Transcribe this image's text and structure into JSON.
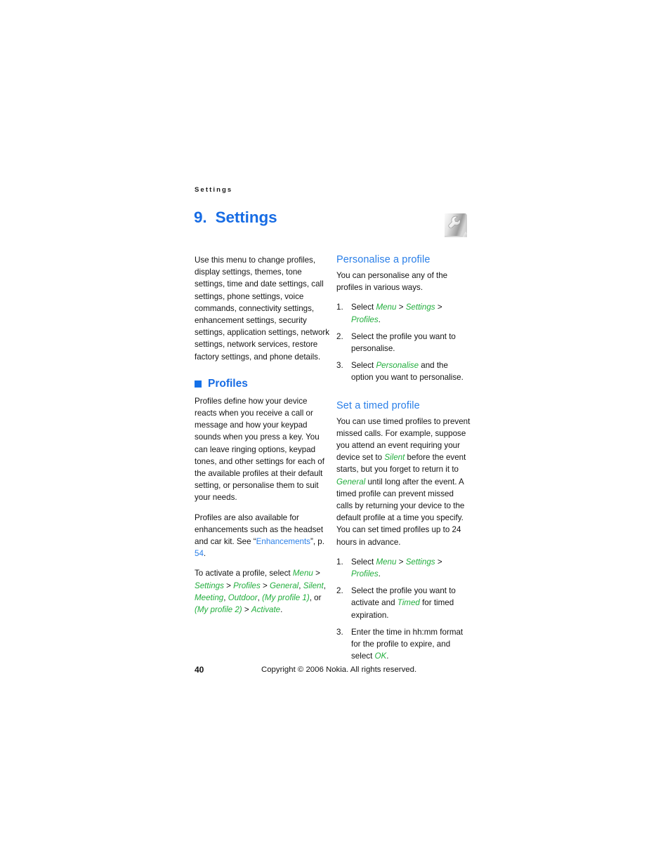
{
  "page": {
    "running_header": "Settings",
    "footer_page_number": "40",
    "footer_copyright": "Copyright © 2006 Nokia. All rights reserved.",
    "colors": {
      "heading_blue": "#176ce4",
      "subheading_blue": "#2a7fe8",
      "menu_green": "#22ae3d",
      "link_blue": "#2a7fe8",
      "body_black": "#141414"
    }
  },
  "chapter": {
    "number": "9.",
    "title": "Settings",
    "icon": "wrench-icon"
  },
  "intro": {
    "text": "Use this menu to change profiles, display settings, themes, tone settings, time and date settings, call settings, phone settings, voice commands, connectivity settings, enhancement settings, security settings, application settings, network settings, network services, restore factory settings, and phone details."
  },
  "profiles_section": {
    "heading": "Profiles",
    "para_1": "Profiles define how your device reacts when you receive a call or message and how your keypad sounds when you press a key. You can leave ringing options, keypad tones, and other settings for each of the available profiles at their default setting, or personalise them to suit your needs.",
    "para_2": {
      "before": "Profiles are also available for enhancements such as the headset and car kit. See “",
      "link": "Enhancements",
      "middle": "”, p. ",
      "page_ref": "54",
      "after": "."
    },
    "para_3": {
      "before": "To activate a profile, select ",
      "menu_1": "Menu",
      "sep_1": " > ",
      "menu_2": "Settings",
      "sep_2": " > ",
      "menu_3": "Profiles",
      "sep_3": " > ",
      "menu_4": "General",
      "comma_1": ", ",
      "menu_5": "Silent",
      "comma_2": ", ",
      "menu_6": "Meeting",
      "comma_3": ", ",
      "menu_7": "Outdoor",
      "comma_4": ", ",
      "menu_8": "(My profile 1)",
      "or_text": ", or ",
      "menu_9": "(My profile 2)",
      "sep_4": " > ",
      "menu_10": "Activate",
      "after": "."
    }
  },
  "personalise_section": {
    "heading": "Personalise a profile",
    "intro": "You can personalise any of the profiles in various ways.",
    "steps": [
      {
        "before": "Select ",
        "menu_1": "Menu",
        "sep_1": " > ",
        "menu_2": "Settings",
        "sep_2": " > ",
        "menu_3": "Profiles",
        "after": "."
      },
      {
        "before": "Select the profile you want to personalise.",
        "after": ""
      },
      {
        "before": "Select ",
        "menu_1": "Personalise",
        "after": " and the option you want to personalise."
      }
    ]
  },
  "timed_section": {
    "heading": "Set a timed profile",
    "para_1": {
      "p1": "You can use timed profiles to prevent missed calls. For example, suppose you attend an event requiring your device set to ",
      "menu_1": "Silent",
      "p2": " before the event starts, but you forget to return it to ",
      "menu_2": "General",
      "p3": " until long after the event. A timed profile can prevent missed calls by returning your device to the default profile at a time you specify. You can set timed profiles up to 24 hours in advance."
    },
    "steps": [
      {
        "before": "Select ",
        "menu_1": "Menu",
        "sep_1": " > ",
        "menu_2": "Settings",
        "sep_2": " > ",
        "menu_3": "Profiles",
        "after": "."
      },
      {
        "before": "Select the profile you want to activate and ",
        "menu_1": "Timed",
        "after": " for timed expiration."
      },
      {
        "before": "Enter the time in hh:mm format for the profile to expire, and select ",
        "menu_1": "OK",
        "after": "."
      }
    ]
  }
}
